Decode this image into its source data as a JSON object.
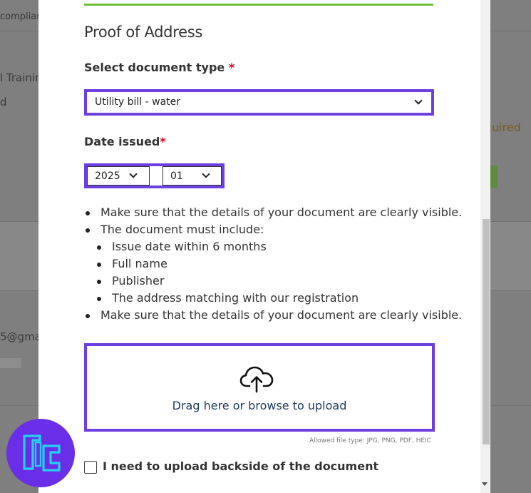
{
  "background": {
    "fragments": [
      "complian",
      "l Training",
      "d",
      "uired",
      "5@gmail"
    ]
  },
  "modal": {
    "title": "Proof of Address",
    "document_type": {
      "label": "Select document type",
      "required_mark": "*",
      "selected": "Utility bill - water"
    },
    "date_issued": {
      "label": "Date issued",
      "required_mark": "*",
      "year": "2025",
      "month": "01"
    },
    "instructions": [
      "Make sure that the details of your document are clearly visible.",
      "The document must include:",
      "Issue date within 6 months",
      "Full name",
      "Publisher",
      "The address matching with our registration",
      "Make sure that the details of your document are clearly visible."
    ],
    "upload": {
      "text": "Drag here or browse to upload",
      "icon": "cloud-upload-icon"
    },
    "allowed_types": "Allowed file type: JPG, PNG, PDF, HEIC",
    "backside_checkbox": {
      "label": "I need to upload backside of the document",
      "checked": false
    }
  },
  "colors": {
    "accent_border": "#6b3fe0",
    "top_line": "#6cbf3a",
    "required": "#d0021b",
    "logo_bg": "#6a2ee8",
    "logo_fg": "#22d3ee"
  }
}
